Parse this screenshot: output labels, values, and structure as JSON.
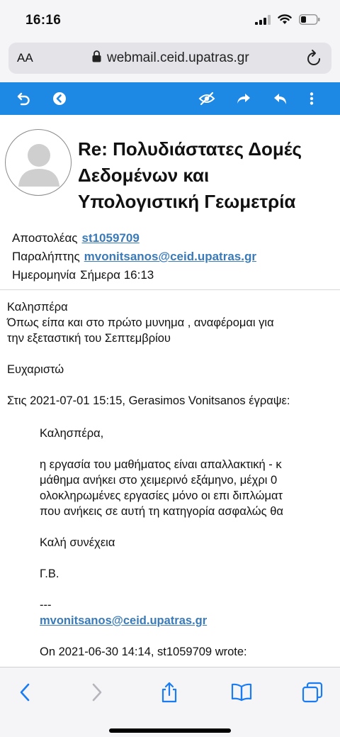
{
  "status": {
    "time": "16:16"
  },
  "browser": {
    "text_size_label": "AA",
    "url": "webmail.ceid.upatras.gr"
  },
  "colors": {
    "toolbar": "#1e88e5",
    "link": "#3a7ab8",
    "ios_blue": "#1a7cf5"
  },
  "mail_toolbar": {
    "icons": [
      "back-icon",
      "left-arrow-icon",
      "hide-icon",
      "forward-icon",
      "reply-icon",
      "more-icon"
    ]
  },
  "message": {
    "subject": "Re: Πολυδιάστατες Δομές Δεδομένων και Υπολογιστική Γεωμετρία",
    "sender_label": "Αποστολέας",
    "sender": "st1059709",
    "recipient_label": "Παραλήπτης",
    "recipient": "mvonitsanos@ceid.upatras.gr",
    "date_label": "Ημερομηνία",
    "date": "Σήμερα 16:13",
    "body_lines": [
      "Καλησπέρα",
      "Όπως είπα και στο πρώτο μυνημα , αναφέρομαι για",
      "την εξεταστική του Σεπτεμβρίου",
      "",
      "Ευχαριστώ",
      "",
      "Στις 2021-07-01 15:15, Gerasimos Vonitsanos έγραψε:"
    ],
    "quoted": {
      "greeting": "Καλησπέρα,",
      "lines": [
        "η εργασία του μαθήματος είναι απαλλακτική - κ",
        "μάθημα ανήκει στο χειμερινό εξάμηνο, μέχρι 0",
        "ολοκληρωμένες εργασίες μόνο οι επι διπλώματ",
        "που ανήκεις σε αυτή τη κατηγορία ασφαλώς θα"
      ],
      "closing": "Καλή συνέχεια",
      "signature": "Γ.Β.",
      "separator": "---",
      "email": "mvonitsanos@ceid.upatras.gr",
      "wrote_line": "On 2021-06-30 14:14, st1059709 wrote:"
    }
  },
  "safari_toolbar": {
    "icons": [
      "back-icon",
      "forward-icon",
      "share-icon",
      "bookmarks-icon",
      "tabs-icon"
    ]
  }
}
